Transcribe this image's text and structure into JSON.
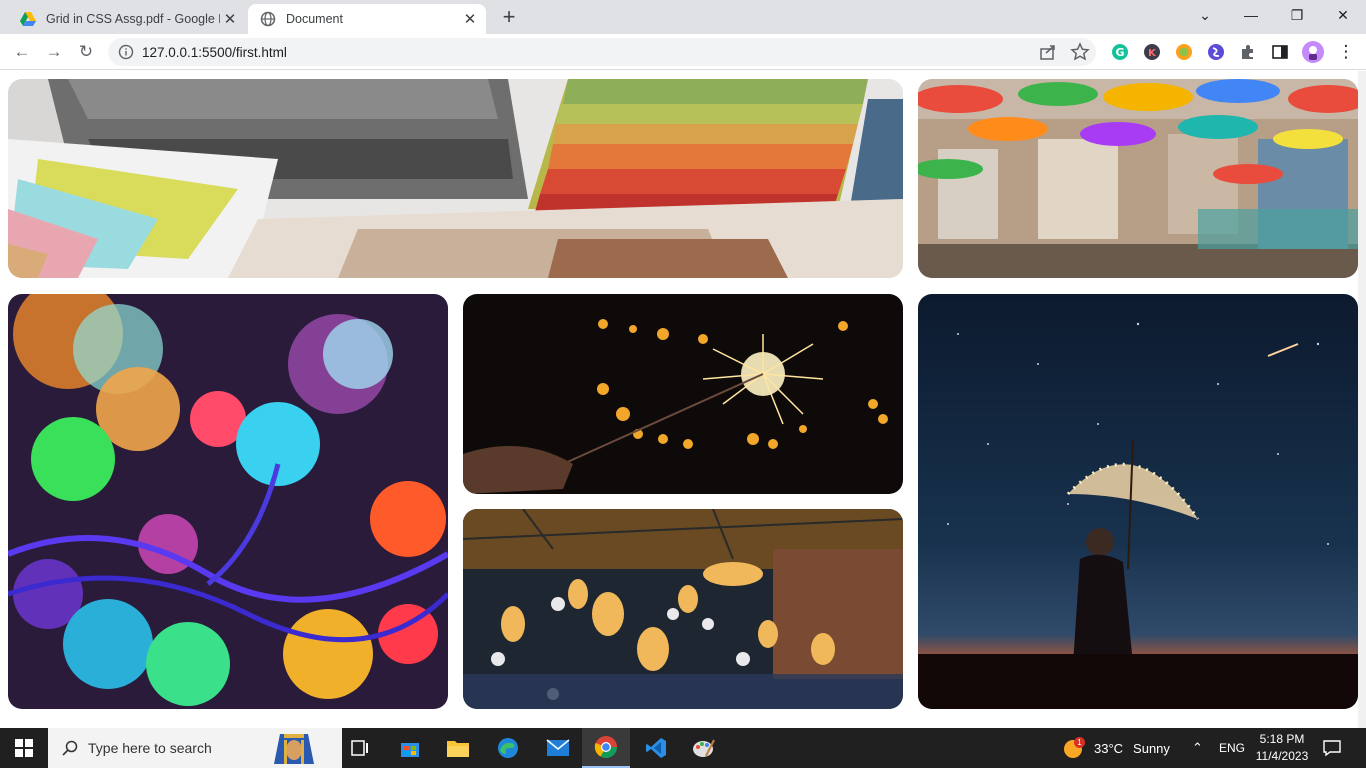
{
  "browser": {
    "tabs": [
      {
        "title": "Grid in CSS Assg.pdf - Google D",
        "favicon": "google-drive-icon",
        "active": false
      },
      {
        "title": "Document",
        "favicon": "globe-icon",
        "active": true
      }
    ],
    "address": {
      "url": "127.0.0.1:5500/first.html"
    },
    "extensions": [
      "grammarly-icon",
      "k-extension-icon",
      "50-extension-icon",
      "sigma-extension-icon",
      "puzzle-icon",
      "sidepanel-icon",
      "profile-avatar"
    ]
  },
  "gallery": {
    "images": [
      {
        "id": "fabric",
        "subject": "fabric-swatches"
      },
      {
        "id": "umbrella",
        "subject": "umbrella-street"
      },
      {
        "id": "bokeh",
        "subject": "colorful-bokeh-lights"
      },
      {
        "id": "sparkler",
        "subject": "sparkler"
      },
      {
        "id": "bulbs",
        "subject": "hanging-bulbs"
      },
      {
        "id": "night",
        "subject": "woman-with-lit-umbrella"
      }
    ]
  },
  "taskbar": {
    "search_placeholder": "Type here to search",
    "weather": {
      "temp": "33°C",
      "condition": "Sunny",
      "badge": "1"
    },
    "language": "ENG",
    "time": "5:18 PM",
    "date": "11/4/2023"
  },
  "colors": {
    "chrome_bg": "#dfe1e5",
    "taskbar_bg": "#202020",
    "accent": "#1a73e8"
  }
}
